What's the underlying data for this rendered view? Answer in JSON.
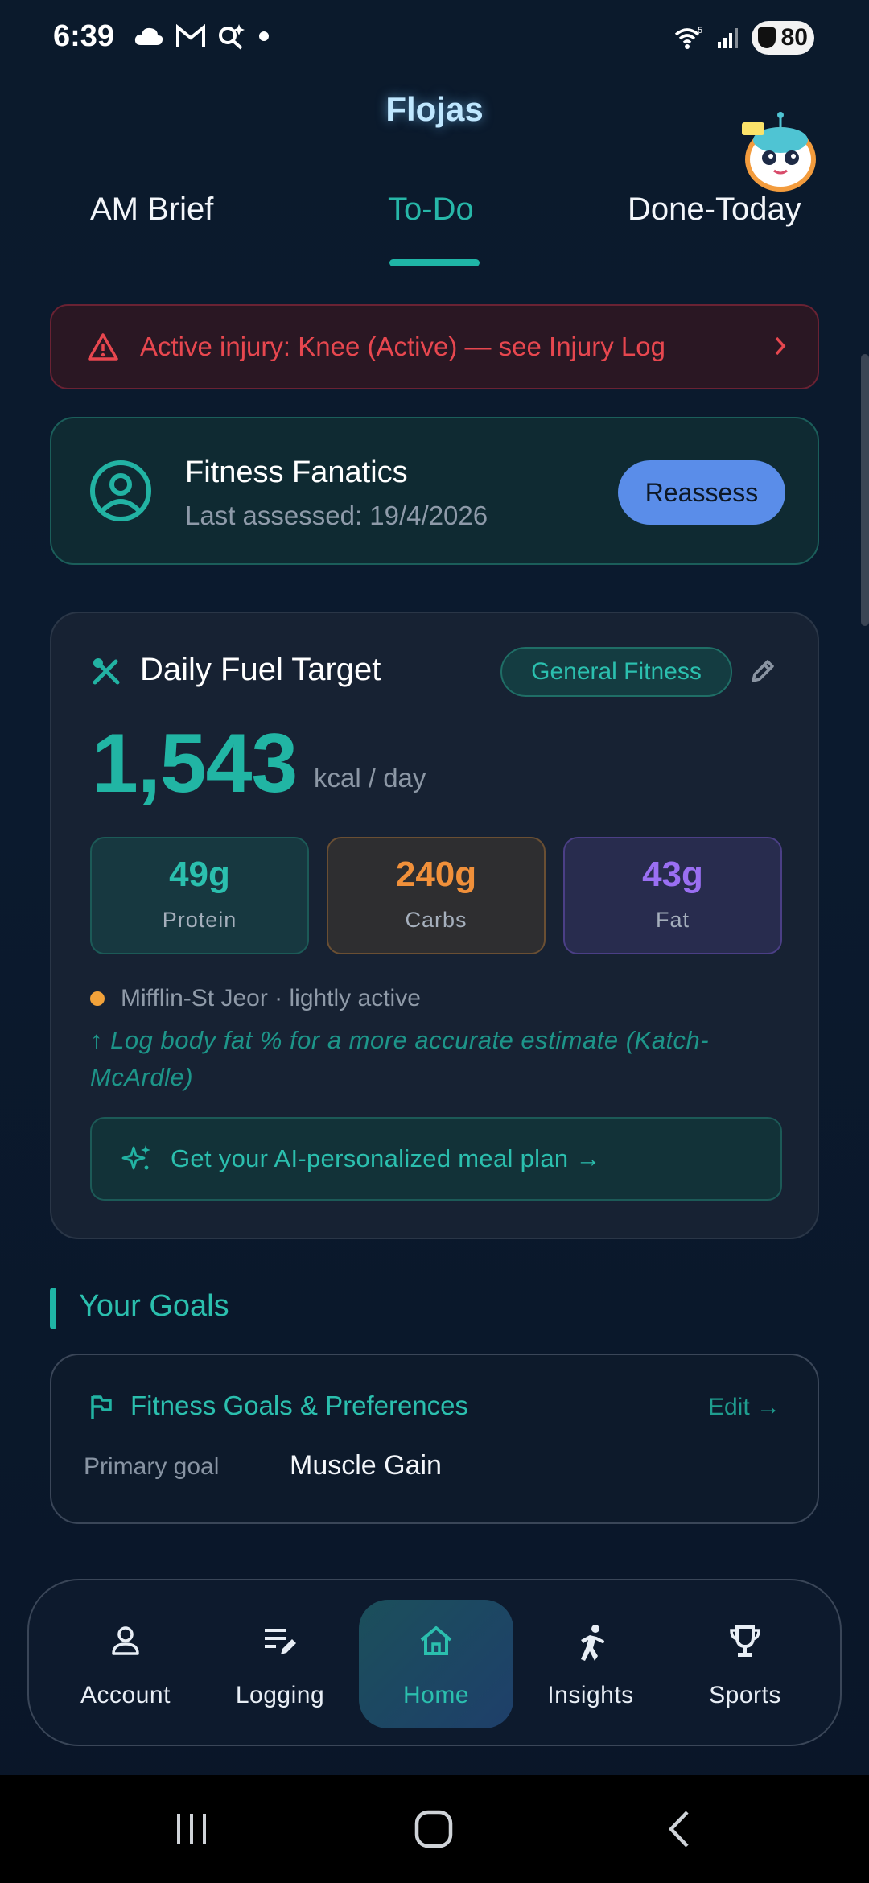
{
  "status_bar": {
    "time": "6:39",
    "battery": "80"
  },
  "app": {
    "title": "Flojas"
  },
  "tabs": [
    {
      "label": "AM Brief"
    },
    {
      "label": "To-Do"
    },
    {
      "label": "Done-Today"
    }
  ],
  "injury_banner": {
    "text": "Active injury: Knee (Active) — see Injury Log"
  },
  "profile": {
    "name": "Fitness Fanatics",
    "last_assessed": "Last assessed: 19/4/2026",
    "reassess_label": "Reassess"
  },
  "fuel": {
    "title": "Daily Fuel Target",
    "goal_tag": "General Fitness",
    "kcal": "1,543",
    "kcal_unit": "kcal / day",
    "macros": [
      {
        "value": "49g",
        "label": "Protein"
      },
      {
        "value": "240g",
        "label": "Carbs"
      },
      {
        "value": "43g",
        "label": "Fat"
      }
    ],
    "method": "Mifflin-St Jeor · lightly active",
    "hint": "↑ Log body fat % for a more accurate estimate (Katch-McArdle)",
    "ai_cta": "Get your AI-personalized meal plan →"
  },
  "goals": {
    "heading": "Your Goals",
    "card_title": "Fitness Goals & Preferences",
    "edit_label": "Edit →",
    "primary_label": "Primary goal",
    "primary_value": "Muscle Gain"
  },
  "bottom_nav": [
    {
      "label": "Account"
    },
    {
      "label": "Logging"
    },
    {
      "label": "Home"
    },
    {
      "label": "Insights"
    },
    {
      "label": "Sports"
    }
  ],
  "colors": {
    "accent_teal": "#21b5a4",
    "danger": "#e7474f",
    "primary_button": "#5a8de9",
    "carbs": "#f0903a",
    "fat": "#9a6ff2"
  }
}
